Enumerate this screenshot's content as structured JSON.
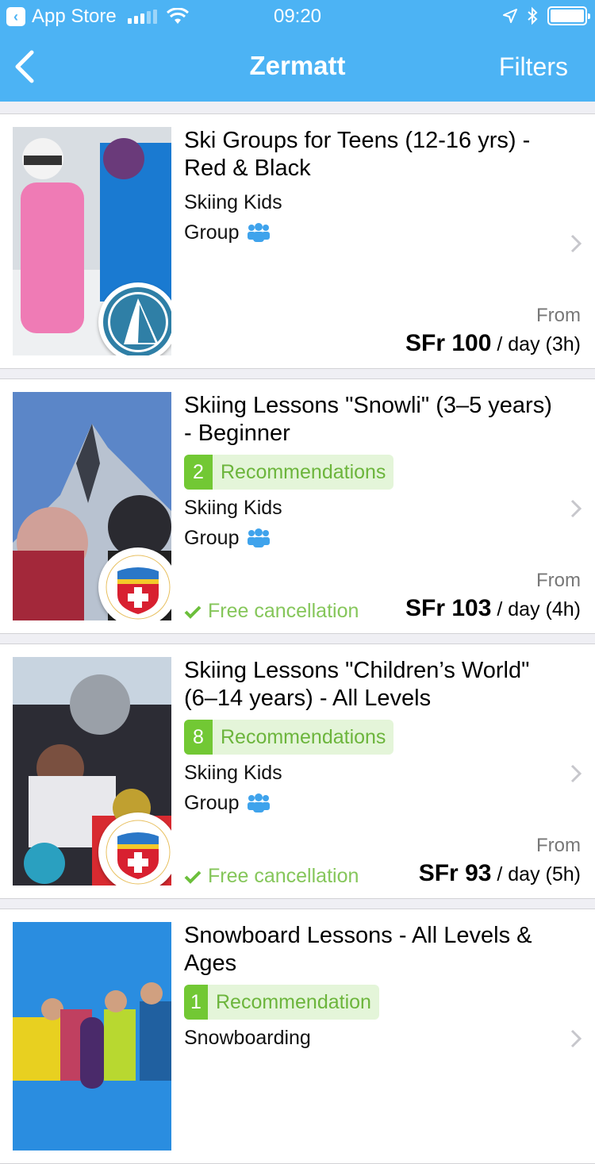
{
  "status_bar": {
    "back_app": "App Store",
    "time": "09:20"
  },
  "nav": {
    "title": "Zermatt",
    "filters_label": "Filters"
  },
  "colors": {
    "header_bg": "#4cb3f4",
    "reco_green": "#72c834",
    "free_cancel_green": "#85c65a",
    "group_icon_blue": "#3fa3ec"
  },
  "listings": [
    {
      "title": "Ski Groups for Teens (12-16 yrs) - Red & Black",
      "recommendations": null,
      "category": "Skiing Kids",
      "type": "Group",
      "type_icon": "group-icon",
      "free_cancellation": null,
      "from_label": "From",
      "price": "SFr 100",
      "unit": "/ day (3h)",
      "provider_logo": "mountain-logo"
    },
    {
      "title": "Skiing Lessons \"Snowli\" (3–5 years) - Beginner",
      "recommendations": {
        "count": "2",
        "label": "Recommendations"
      },
      "category": "Skiing Kids",
      "type": "Group",
      "type_icon": "group-icon",
      "free_cancellation": "Free cancellation",
      "from_label": "From",
      "price": "SFr 103",
      "unit": "/ day (4h)",
      "provider_logo": "swiss-ski-school-logo"
    },
    {
      "title": "Skiing Lessons \"Children’s World\" (6–14 years) - All Levels",
      "recommendations": {
        "count": "8",
        "label": "Recommendations"
      },
      "category": "Skiing Kids",
      "type": "Group",
      "type_icon": "group-icon",
      "free_cancellation": "Free cancellation",
      "from_label": "From",
      "price": "SFr 93",
      "unit": "/ day (5h)",
      "provider_logo": "swiss-ski-school-logo"
    },
    {
      "title": "Snowboard Lessons - All Levels & Ages",
      "recommendations": {
        "count": "1",
        "label": "Recommendation"
      },
      "category": "Snowboarding"
    }
  ]
}
